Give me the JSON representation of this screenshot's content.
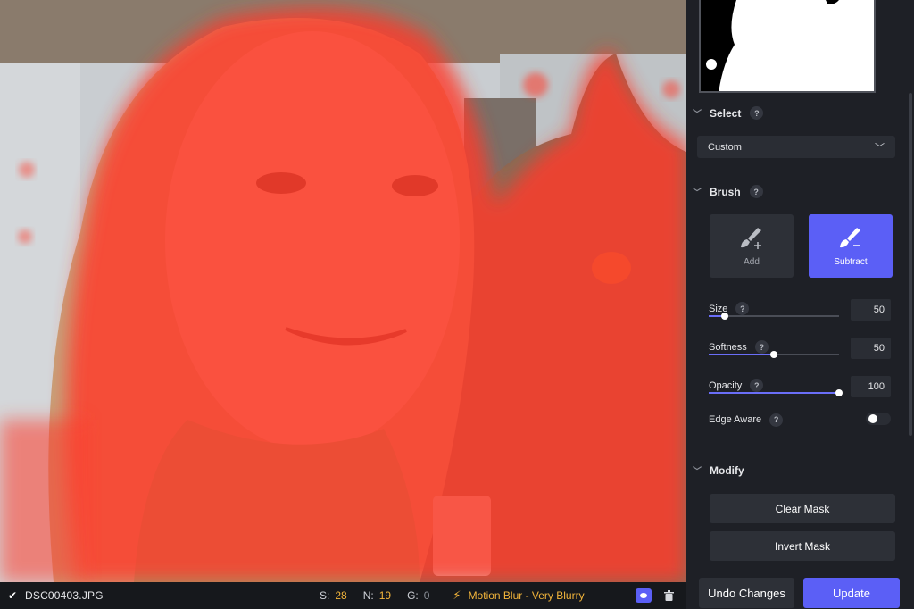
{
  "photo": {
    "filename": "DSC00403.JPG",
    "stats": [
      {
        "key": "S:",
        "value": "28"
      },
      {
        "key": "N:",
        "value": "19"
      },
      {
        "key": "G:",
        "value": "0"
      }
    ],
    "blur_label": "Motion Blur - Very Blurry",
    "mask_color": "#ff3b2a"
  },
  "panel": {
    "select": {
      "label": "Select",
      "value": "Custom"
    },
    "brush": {
      "label": "Brush",
      "add_label": "Add",
      "subtract_label": "Subtract",
      "active": "Subtract"
    },
    "sliders": [
      {
        "label": "Size",
        "value": "50",
        "fraction": 0.12
      },
      {
        "label": "Softness",
        "value": "50",
        "fraction": 0.5
      },
      {
        "label": "Opacity",
        "value": "100",
        "fraction": 1.0
      }
    ],
    "edge_aware": {
      "label": "Edge Aware",
      "enabled": false
    },
    "modify": {
      "label": "Modify",
      "clear_label": "Clear Mask",
      "invert_label": "Invert Mask"
    },
    "help_glyph": "?",
    "undo_label": "Undo Changes",
    "update_label": "Update"
  },
  "colors": {
    "accent": "#5b5ff6",
    "warning": "#f3b53b",
    "panel_bg": "#1e2026"
  }
}
